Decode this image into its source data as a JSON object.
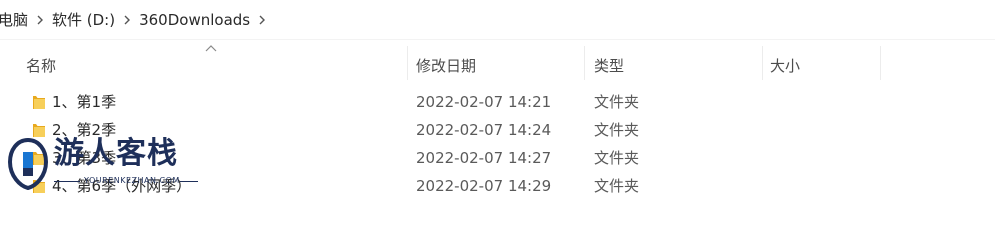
{
  "breadcrumb": {
    "items": [
      "电脑",
      "软件 (D:)",
      "360Downloads"
    ]
  },
  "columns": {
    "name": "名称",
    "date": "修改日期",
    "type": "类型",
    "size": "大小"
  },
  "rows": [
    {
      "name": "1、第1季",
      "date": "2022-02-07 14:21",
      "type": "文件夹",
      "size": ""
    },
    {
      "name": "2、第2季",
      "date": "2022-02-07 14:24",
      "type": "文件夹",
      "size": ""
    },
    {
      "name": "3、第3季",
      "date": "2022-02-07 14:27",
      "type": "文件夹",
      "size": ""
    },
    {
      "name": "4、第6季（外网季）",
      "date": "2022-02-07 14:29",
      "type": "文件夹",
      "size": ""
    }
  ],
  "watermark": {
    "title": "游人客栈",
    "subtitle": "YOURENKEZHAN.COM"
  },
  "icons": {
    "folder": "folder-icon",
    "separator": "chevron-right-icon",
    "sort": "sort-ascending-icon",
    "logo": "logo-badge-icon"
  },
  "colors": {
    "folder": "#f4c542",
    "watermark": "#1e2f5a",
    "accent": "#1976d2"
  }
}
